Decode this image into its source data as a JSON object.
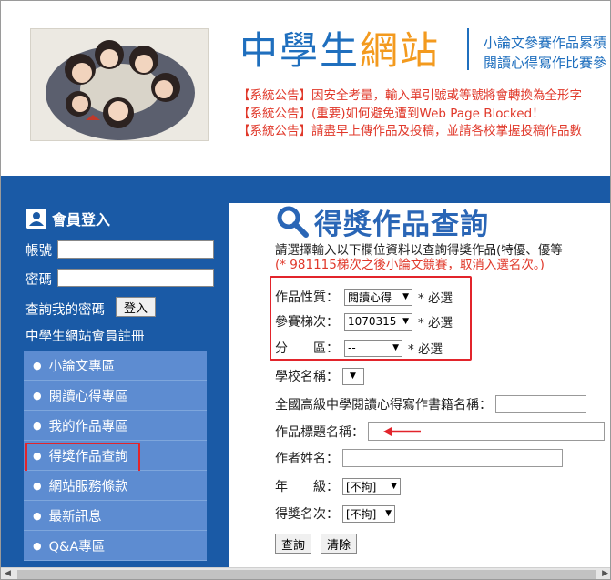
{
  "header": {
    "logo_part1": "中學生",
    "logo_part2": "網站",
    "tagline_1": "小論文參賽作品累積",
    "tagline_2": "閱讀心得寫作比賽參",
    "notices": [
      "【系統公告】因安全考量，輸入單引號或等號將會轉換為全形字",
      "【系統公告】(重要)如何避免遭到Web Page Blocked！",
      "【系統公告】請盡早上傳作品及投稿，並請各校掌握投稿作品數"
    ]
  },
  "sidebar": {
    "login_title": "會員登入",
    "account_label": "帳號",
    "password_label": "密碼",
    "forgot_password": "查詢我的密碼",
    "login_button": "登入",
    "register": "中學生網站會員註冊",
    "menu": [
      "小論文專區",
      "閱讀心得專區",
      "我的作品專區",
      "得獎作品查詢",
      "網站服務條款",
      "最新訊息",
      "Q&A專區"
    ]
  },
  "main": {
    "title": "得獎作品查詢",
    "description": "請選擇輸入以下欄位資料以查詢得獎作品(特優、優等",
    "description_note": "(* 981115梯次之後小論文競賽，取消入選名次。)",
    "fields": {
      "category_label": "作品性質：",
      "category_value": "閱讀心得",
      "round_label": "參賽梯次：",
      "round_value": "1070315",
      "region_label": "分　　區：",
      "region_value": "--",
      "required_text": "* 必選",
      "school_label": "學校名稱：",
      "book_label": "全國高級中學閱讀心得寫作書籍名稱：",
      "work_title_label": "作品標題名稱：",
      "author_label": "作者姓名：",
      "grade_label": "年　　級：",
      "grade_value": "[不拘]",
      "award_label": "得獎名次：",
      "award_value": "[不拘]"
    },
    "query_button": "查詢",
    "clear_button": "清除"
  },
  "colors": {
    "brand_blue": "#1a5aa6",
    "menu_blue": "#5d8cd1",
    "logo_orange": "#f39a1e",
    "notice_red": "#e0382a",
    "highlight_red": "#e2242b"
  }
}
